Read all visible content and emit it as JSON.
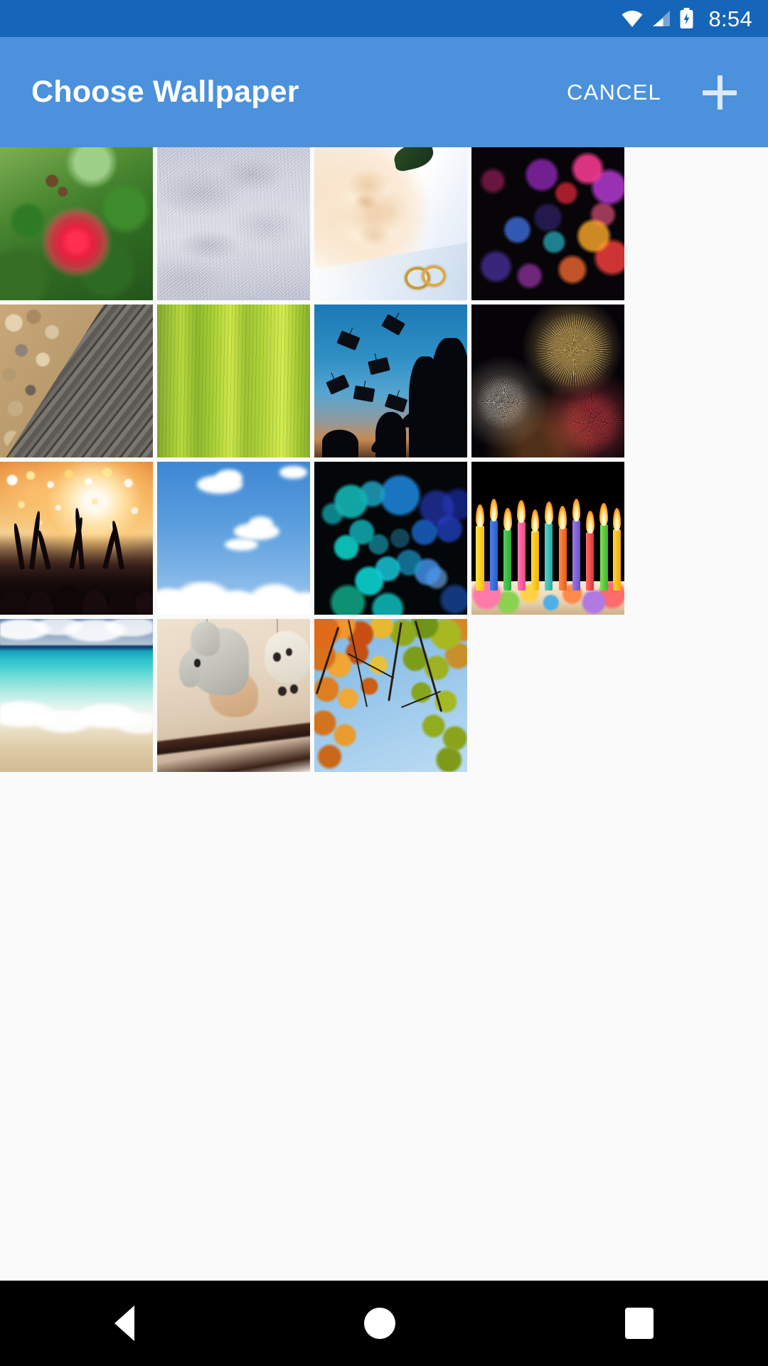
{
  "status_bar": {
    "time": "8:54",
    "icons": [
      {
        "name": "wifi-icon",
        "label": "Wi-Fi connected"
      },
      {
        "name": "cellular-signal-icon",
        "label": "Cellular signal"
      },
      {
        "name": "battery-charging-icon",
        "label": "Battery charging"
      }
    ],
    "background_color": "#1565b8"
  },
  "app_bar": {
    "title": "Choose Wallpaper",
    "cancel_label": "CANCEL",
    "add_icon_name": "plus-icon",
    "background_color": "#4b91dc",
    "text_color": "#ffffff"
  },
  "grid": {
    "columns": 4,
    "tile_count": 15,
    "background_color": "#fafafa",
    "tiles": [
      {
        "id": 1,
        "name": "wallpaper-red-powderpuff-flower",
        "description": "Red powderpuff flower with green foliage"
      },
      {
        "id": 2,
        "name": "wallpaper-snow-texture",
        "description": "Sparkling white snow surface"
      },
      {
        "id": 3,
        "name": "wallpaper-rose-wedding-rings",
        "description": "Cream rose on white satin with gold wedding rings"
      },
      {
        "id": 4,
        "name": "wallpaper-colorful-bokeh",
        "description": "Multicolored bokeh lights on black"
      },
      {
        "id": 5,
        "name": "wallpaper-pebbles-decking",
        "description": "Gravel pebbles beside grey wooden decking"
      },
      {
        "id": 6,
        "name": "wallpaper-green-leaf-macro",
        "description": "Bright green striped leaf macro"
      },
      {
        "id": 7,
        "name": "wallpaper-graduation-caps",
        "description": "Graduation caps tossed into a blue sky"
      },
      {
        "id": 8,
        "name": "wallpaper-fireworks",
        "description": "Gold and red fireworks bursting on black"
      },
      {
        "id": 9,
        "name": "wallpaper-concert-crowd",
        "description": "Concert crowd silhouettes under warm stage lights"
      },
      {
        "id": 10,
        "name": "wallpaper-blue-sky-clouds",
        "description": "Blue sky with white cumulus clouds"
      },
      {
        "id": 11,
        "name": "wallpaper-cyan-bokeh",
        "description": "Cyan and blue bokeh circles on black"
      },
      {
        "id": 12,
        "name": "wallpaper-birthday-candles",
        "description": "Lit colorful birthday candles on a cake"
      },
      {
        "id": 13,
        "name": "wallpaper-tropical-beach",
        "description": "Turquoise sea washing onto a sandy beach"
      },
      {
        "id": 14,
        "name": "wallpaper-baby-mobile-elephant",
        "description": "Knitted elephant toy hanging from a baby mobile"
      },
      {
        "id": 15,
        "name": "wallpaper-autumn-canopy",
        "description": "Autumn maple leaves against blue sky"
      }
    ]
  },
  "nav_bar": {
    "background_color": "#000000",
    "buttons": [
      {
        "name": "nav-back-button",
        "label": "Back"
      },
      {
        "name": "nav-home-button",
        "label": "Home"
      },
      {
        "name": "nav-recents-button",
        "label": "Recents"
      }
    ]
  }
}
